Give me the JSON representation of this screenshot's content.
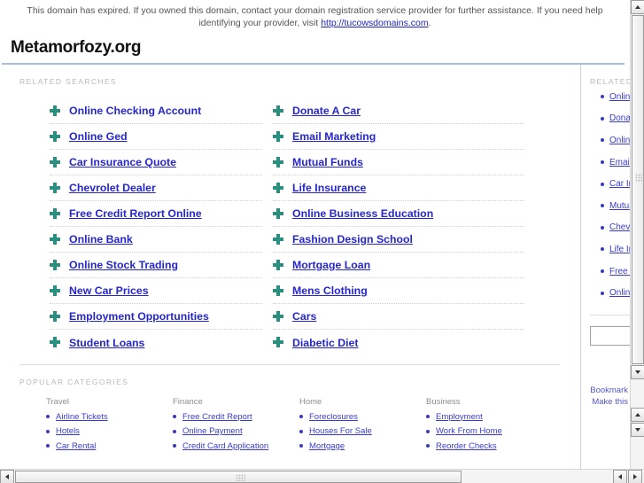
{
  "banner": {
    "text_before": "This domain has expired. If you owned this domain, contact your domain registration service provider for further assistance. If you need help identifying your provider, visit ",
    "link_text": "http://tucowsdomains.com",
    "text_after": "."
  },
  "brand": {
    "domain_title": "Metamorfozy.org"
  },
  "main": {
    "related_label": "RELATED SEARCHES",
    "related_left": [
      {
        "label": "Online Checking Account",
        "underlined": false
      },
      {
        "label": "Online Ged",
        "underlined": true
      },
      {
        "label": "Car Insurance Quote",
        "underlined": true
      },
      {
        "label": "Chevrolet Dealer",
        "underlined": true
      },
      {
        "label": "Free Credit Report Online",
        "underlined": true
      },
      {
        "label": "Online Bank",
        "underlined": true
      },
      {
        "label": "Online Stock Trading",
        "underlined": true
      },
      {
        "label": "New Car Prices",
        "underlined": true
      },
      {
        "label": "Employment Opportunities",
        "underlined": true
      },
      {
        "label": "Student Loans",
        "underlined": true
      }
    ],
    "related_right": [
      {
        "label": "Donate A Car",
        "underlined": true
      },
      {
        "label": "Email Marketing",
        "underlined": true
      },
      {
        "label": "Mutual Funds",
        "underlined": true
      },
      {
        "label": "Life Insurance",
        "underlined": true
      },
      {
        "label": "Online Business Education",
        "underlined": true
      },
      {
        "label": "Fashion Design School",
        "underlined": true
      },
      {
        "label": "Mortgage Loan",
        "underlined": true
      },
      {
        "label": "Mens Clothing",
        "underlined": true
      },
      {
        "label": "Cars",
        "underlined": true
      },
      {
        "label": "Diabetic Diet",
        "underlined": true
      }
    ],
    "popular_label": "POPULAR CATEGORIES",
    "categories": [
      {
        "heading": "Travel",
        "links": [
          "Airline Tickets",
          "Hotels",
          "Car Rental"
        ]
      },
      {
        "heading": "Finance",
        "links": [
          "Free Credit Report",
          "Online Payment",
          "Credit Card Application"
        ]
      },
      {
        "heading": "Home",
        "links": [
          "Foreclosures",
          "Houses For Sale",
          "Mortgage"
        ]
      },
      {
        "heading": "Business",
        "links": [
          "Employment",
          "Work From Home",
          "Reorder Checks"
        ]
      }
    ]
  },
  "sidebar": {
    "related_label": "RELATED",
    "items": [
      "Online Checking Account",
      "Donate A Car",
      "Online Ged",
      "Email Marketing",
      "Car Insurance Quote",
      "Mutual Funds",
      "Chevrolet Dealer",
      "Life Insurance",
      "Free Credit Report Online",
      "Online Business Education"
    ],
    "search_value": "",
    "search_placeholder": "",
    "actions": [
      "Bookmark",
      "Make this"
    ]
  },
  "colors": {
    "link": "#2626cf",
    "small_link": "#3a3ad0",
    "bullet_cross": "#2a8f7f",
    "bullet_dot": "#3b3bc0",
    "label": "#b9b9b9",
    "brand_rule": "#a8bce0"
  },
  "icons": {
    "scroll_up": "scroll-up-arrow-icon",
    "scroll_down": "scroll-down-arrow-icon",
    "scroll_left": "scroll-left-arrow-icon",
    "scroll_right": "scroll-right-arrow-icon"
  }
}
